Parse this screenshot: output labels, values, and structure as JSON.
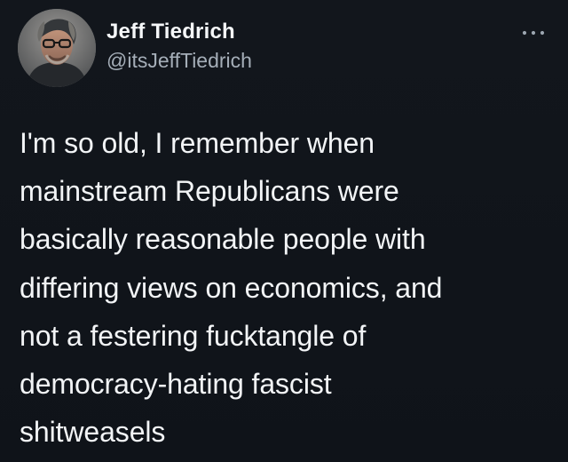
{
  "author": {
    "display_name": "Jeff Tiedrich",
    "handle": "@itsJeffTiedrich",
    "avatar_icon": "profile-photo",
    "more_icon": "more-options-icon"
  },
  "tweet": {
    "text_lines": [
      "I'm so old, I remember when",
      "mainstream Republicans were",
      "basically reasonable people with",
      "differing views on economics, and",
      "not a festering fucktangle of",
      "democracy-hating fascist",
      "shitweasels"
    ]
  },
  "colors": {
    "background": "#11141a",
    "primary_text": "#f2f4f6",
    "secondary_text": "#a5aeb8"
  }
}
